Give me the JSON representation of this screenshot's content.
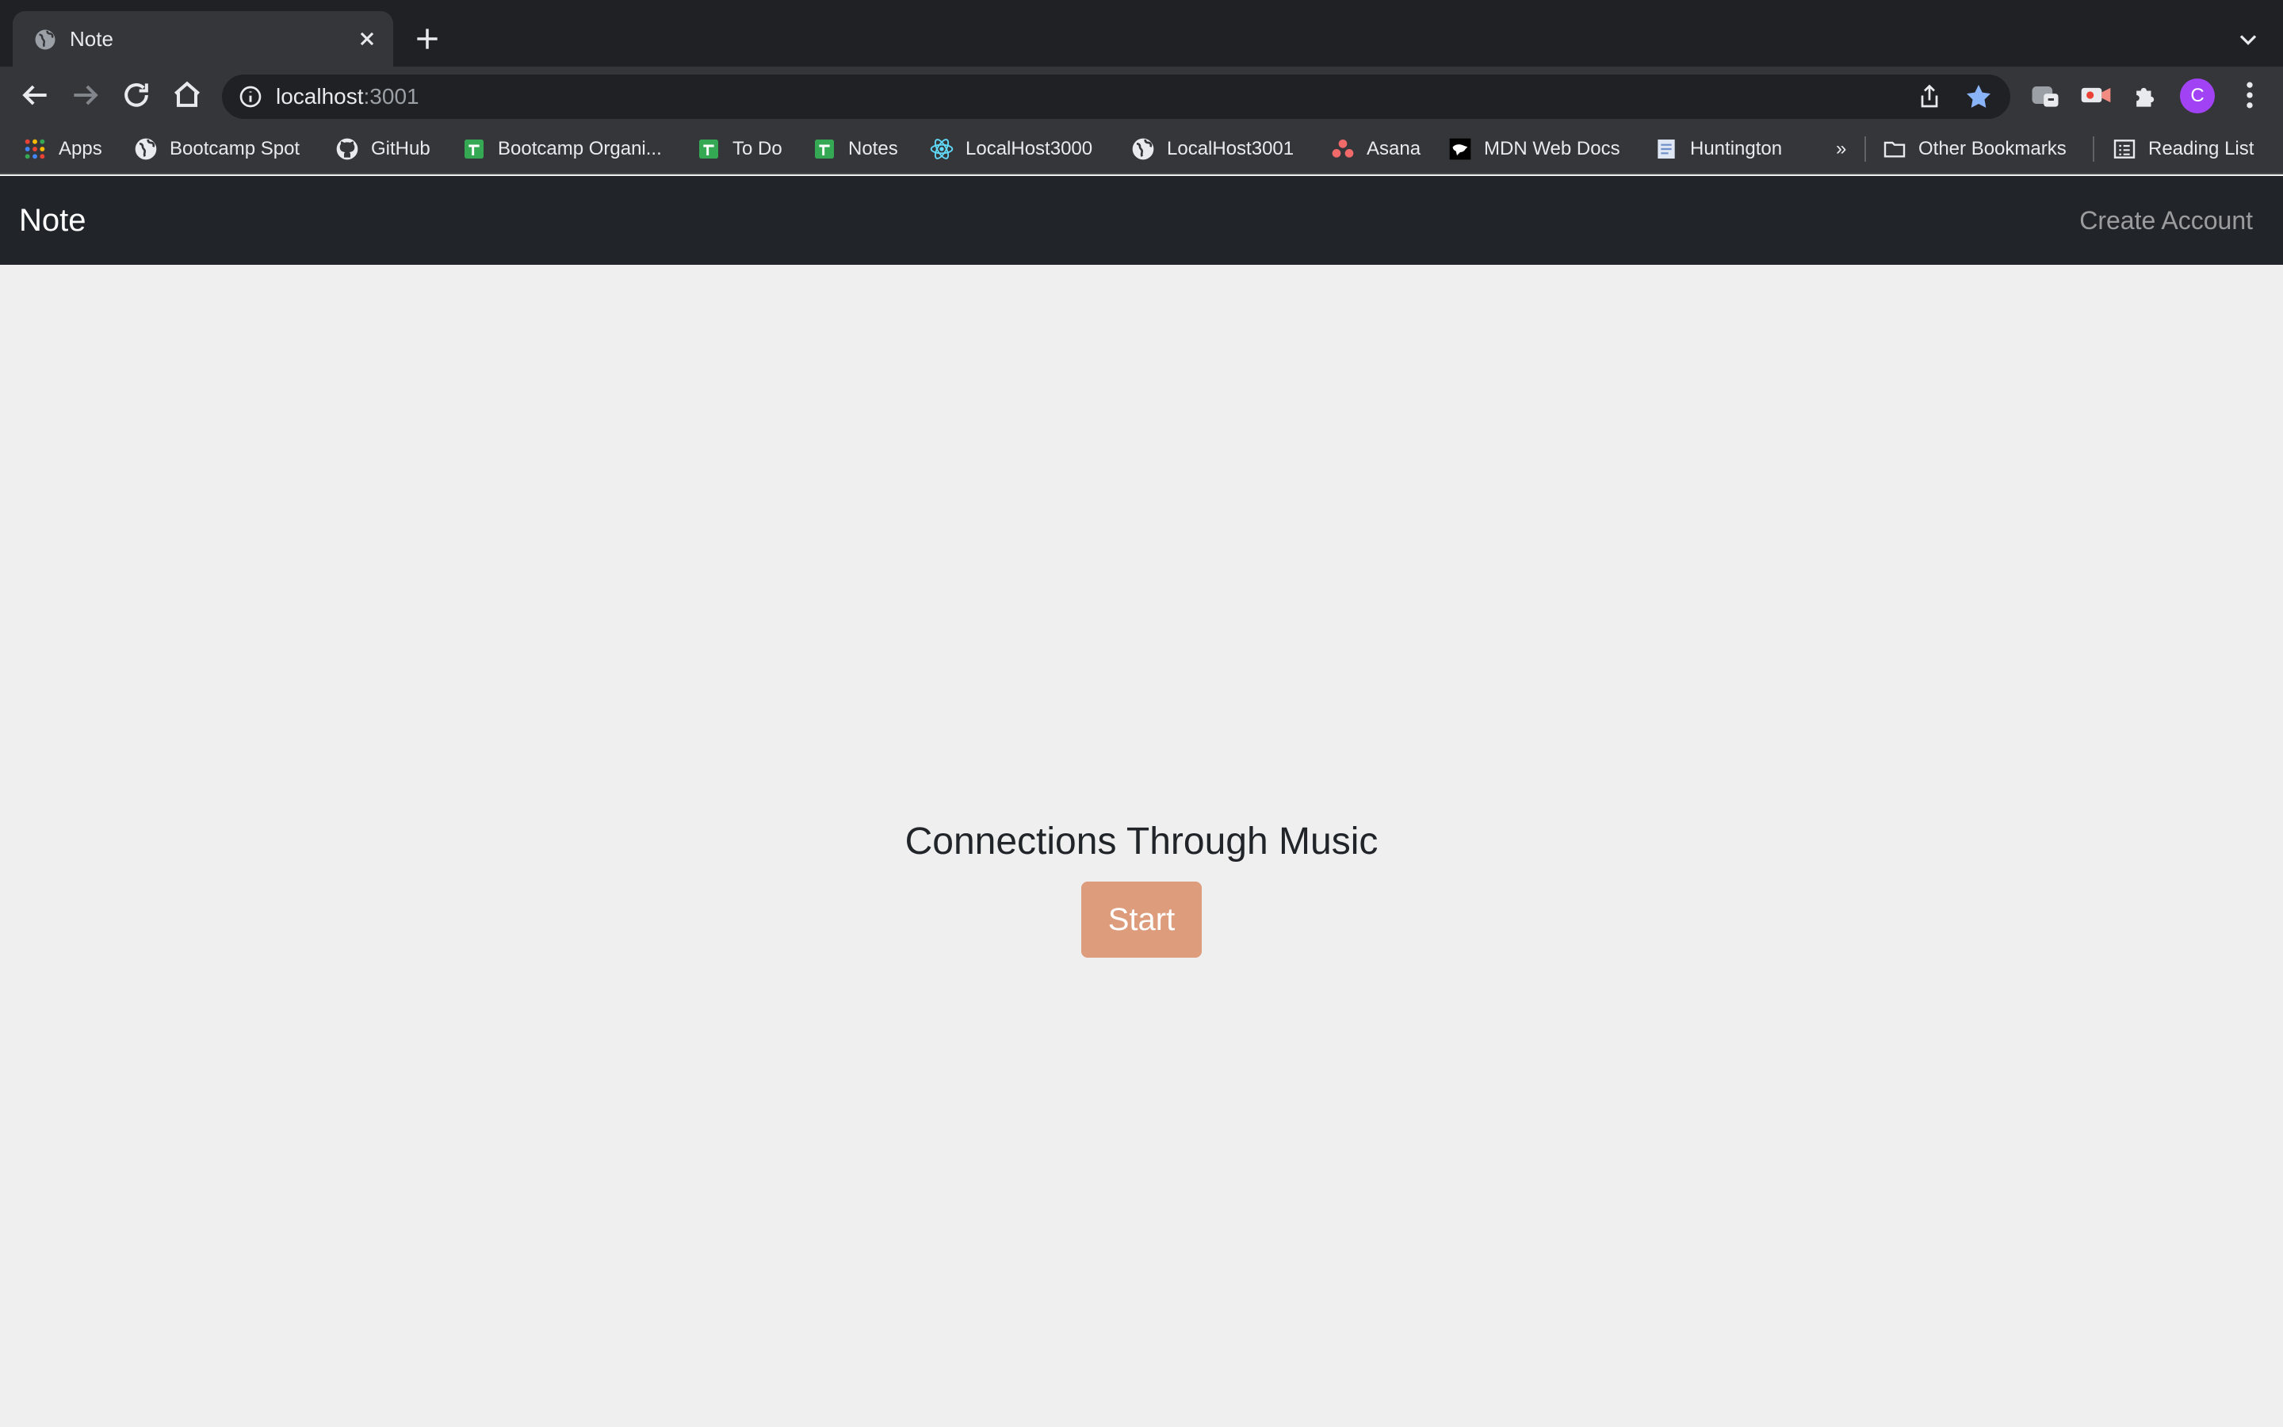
{
  "browser": {
    "tab": {
      "title": "Note",
      "favicon": "globe-icon"
    },
    "address": {
      "host": "localhost",
      "port": ":3001"
    },
    "profile_initial": "C",
    "colors": {
      "chrome_dark": "#202124",
      "chrome_mid": "#35363a",
      "star": "#8ab4f8",
      "avatar": "#a142f4"
    },
    "bookmarks": [
      {
        "label": "Apps",
        "icon": "apps-grid-icon"
      },
      {
        "label": "Bootcamp Spot",
        "icon": "globe-icon"
      },
      {
        "label": "GitHub",
        "icon": "github-icon"
      },
      {
        "label": "Bootcamp Organi...",
        "icon": "sheets-icon"
      },
      {
        "label": "To Do",
        "icon": "sheets-icon"
      },
      {
        "label": "Notes",
        "icon": "sheets-icon"
      },
      {
        "label": "LocalHost3000",
        "icon": "react-icon"
      },
      {
        "label": "LocalHost3001",
        "icon": "globe-icon"
      },
      {
        "label": "Asana",
        "icon": "asana-icon"
      },
      {
        "label": "MDN Web Docs",
        "icon": "mdn-icon"
      },
      {
        "label": "Huntington",
        "icon": "document-icon"
      }
    ],
    "overflow_label": "»",
    "other_bookmarks": "Other Bookmarks",
    "reading_list": "Reading List"
  },
  "page": {
    "brand": "Note",
    "nav_link": "Create Account",
    "headline": "Connections Through Music",
    "start_label": "Start",
    "colors": {
      "navbar": "#212529",
      "background": "#efefef",
      "start_button": "#dd9c7c"
    }
  }
}
